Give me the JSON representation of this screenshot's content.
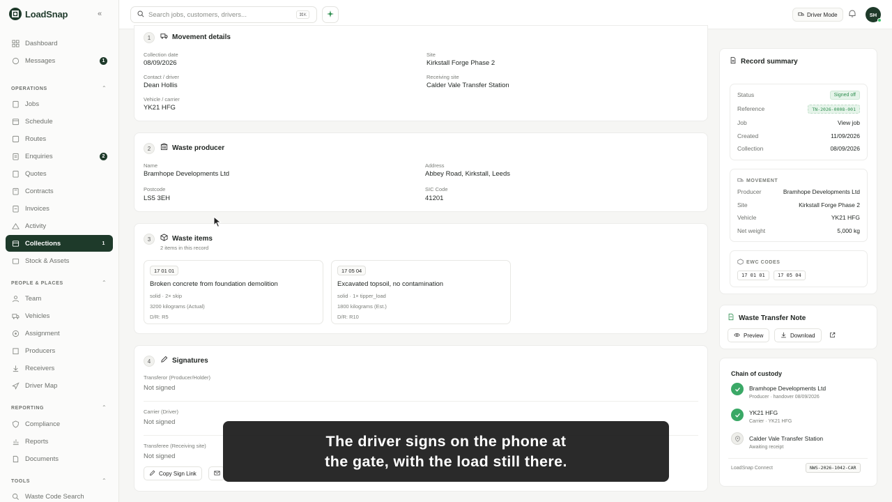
{
  "app": {
    "name": "LoadSnap"
  },
  "search": {
    "placeholder": "Search jobs, customers, drivers...",
    "shortcut": "⌘K"
  },
  "topbar": {
    "driver_mode": "Driver Mode",
    "avatar_initials": "SH"
  },
  "sidebar": {
    "top": [
      {
        "label": "Dashboard",
        "icon": "dashboard-icon"
      },
      {
        "label": "Messages",
        "icon": "message-icon",
        "badge": "1"
      }
    ],
    "operations_label": "OPERATIONS",
    "operations": [
      {
        "label": "Jobs",
        "icon": "clipboard-icon"
      },
      {
        "label": "Schedule",
        "icon": "calendar-icon"
      },
      {
        "label": "Routes",
        "icon": "route-icon"
      },
      {
        "label": "Enquiries",
        "icon": "enquiry-icon",
        "badge": "2"
      },
      {
        "label": "Quotes",
        "icon": "quote-icon"
      },
      {
        "label": "Contracts",
        "icon": "contract-icon"
      },
      {
        "label": "Invoices",
        "icon": "invoice-icon"
      },
      {
        "label": "Activity",
        "icon": "activity-icon"
      },
      {
        "label": "Collections",
        "icon": "collections-icon",
        "badge": "1",
        "active": true
      },
      {
        "label": "Stock & Assets",
        "icon": "stock-icon"
      }
    ],
    "people_label": "PEOPLE & PLACES",
    "people": [
      {
        "label": "Team",
        "icon": "team-icon"
      },
      {
        "label": "Vehicles",
        "icon": "truck-icon"
      },
      {
        "label": "Assignment",
        "icon": "assignment-icon"
      },
      {
        "label": "Producers",
        "icon": "producers-icon"
      },
      {
        "label": "Receivers",
        "icon": "receivers-icon"
      },
      {
        "label": "Driver Map",
        "icon": "map-pin-icon"
      }
    ],
    "reporting_label": "REPORTING",
    "reporting": [
      {
        "label": "Compliance",
        "icon": "shield-icon"
      },
      {
        "label": "Reports",
        "icon": "chart-icon"
      },
      {
        "label": "Documents",
        "icon": "document-icon"
      }
    ],
    "tools_label": "TOOLS",
    "tools": [
      {
        "label": "Waste Code Search",
        "icon": "search-icon"
      }
    ]
  },
  "movement": {
    "step": "1",
    "title": "Movement details",
    "collection_date_label": "Collection date",
    "collection_date": "08/09/2026",
    "contact_label": "Contact / driver",
    "contact": "Dean Hollis",
    "vehicle_label": "Vehicle / carrier",
    "vehicle": "YK21 HFG",
    "site_label": "Site",
    "site": "Kirkstall Forge Phase 2",
    "receiving_label": "Receiving site",
    "receiving": "Calder Vale Transfer Station"
  },
  "producer": {
    "step": "2",
    "title": "Waste producer",
    "name_label": "Name",
    "name": "Bramhope Developments Ltd",
    "postcode_label": "Postcode",
    "postcode": "LS5 3EH",
    "address_label": "Address",
    "address": "Abbey Road, Kirkstall, Leeds",
    "sic_label": "SIC Code",
    "sic": "41201"
  },
  "items": {
    "step": "3",
    "title": "Waste items",
    "subtitle": "2 items in this record",
    "list": [
      {
        "code": "17 01 01",
        "title": "Broken concrete from foundation demolition",
        "meta1": "solid · 2× skip",
        "meta2": "3200 kilograms (Actual)",
        "meta3": "D/R: R5"
      },
      {
        "code": "17 05 04",
        "title": "Excavated topsoil, no contamination",
        "meta1": "solid · 1× tipper_load",
        "meta2": "1800 kilograms (Est.)",
        "meta3": "D/R: R10"
      }
    ]
  },
  "signatures": {
    "step": "4",
    "title": "Signatures",
    "rows": [
      {
        "label": "Transferor (Producer/Holder)",
        "value": "Not signed"
      },
      {
        "label": "Carrier (Driver)",
        "value": "Not signed"
      },
      {
        "label": "Transferee (Receiving site)",
        "value": "Not signed"
      }
    ],
    "copy_link": "Copy Sign Link"
  },
  "summary": {
    "title": "Record summary",
    "status_label": "Status",
    "status": "Signed off",
    "reference_label": "Reference",
    "reference": "TN-2026-0008-001",
    "job_label": "Job",
    "job": "View job",
    "created_label": "Created",
    "created": "11/09/2026",
    "collection_label": "Collection",
    "collection": "08/09/2026",
    "movement_head": "MOVEMENT",
    "producer_label": "Producer",
    "producer": "Bramhope Developments Ltd",
    "site_label": "Site",
    "site": "Kirkstall Forge Phase 2",
    "vehicle_label": "Vehicle",
    "vehicle": "YK21 HFG",
    "net_label": "Net weight",
    "net": "5,000 kg",
    "ewc_head": "EWC CODES",
    "codes": [
      "17 01 01",
      "17 05 04"
    ]
  },
  "wtn": {
    "title": "Waste Transfer Note",
    "preview": "Preview",
    "download": "Download"
  },
  "custody": {
    "title": "Chain of custody",
    "steps": [
      {
        "name": "Bramhope Developments Ltd",
        "sub": "Producer · handover 08/09/2026",
        "done": true
      },
      {
        "name": "YK21 HFG",
        "sub": "Carrier · YK21 HFG",
        "done": true
      },
      {
        "name": "Calder Vale Transfer Station",
        "sub": "Awaiting receipt",
        "done": false
      }
    ],
    "connect_label": "LoadSnap Connect",
    "connect_code": "NWS-2026-1042-CAR"
  },
  "caption": {
    "line1": "The driver signs on the phone at",
    "line2": "the gate, with the load still there."
  },
  "colors": {
    "brand": "#1e3a2a",
    "accent_green": "#2f8f50",
    "bg": "#f6f6f4"
  }
}
